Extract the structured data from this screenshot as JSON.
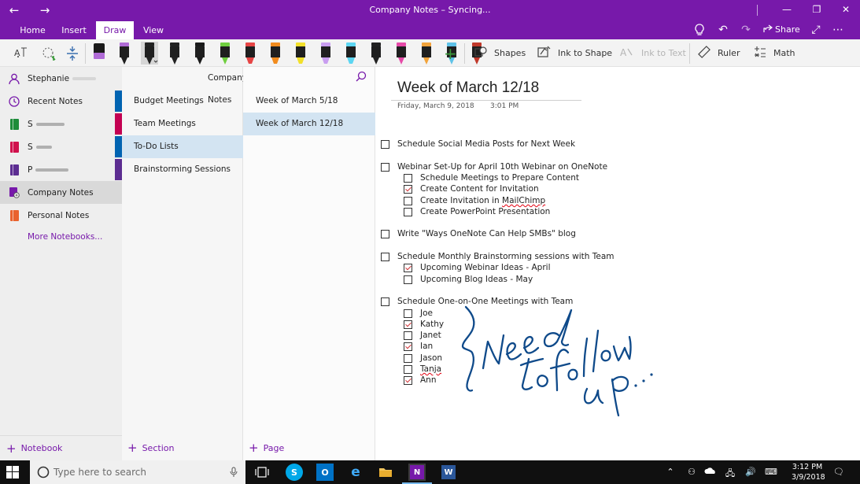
{
  "titlebar": {
    "title": "Company Notes – Syncing...",
    "back_icon": "←",
    "forward_icon": "→",
    "minimize_icon": "—",
    "restore_icon": "❐",
    "close_icon": "✕"
  },
  "ribbon": {
    "tabs": [
      {
        "label": "Home"
      },
      {
        "label": "Insert"
      },
      {
        "label": "Draw"
      },
      {
        "label": "View"
      }
    ],
    "active_tab": "Draw",
    "share_label": "Share",
    "lightbulb_icon": "💡",
    "undo_icon": "↶",
    "redo_icon": "↷",
    "fullscreen_icon": "⤢",
    "more_icon": "⋯"
  },
  "toolbar": {
    "pen_colors": [
      "#b06bd6",
      "#222222",
      "#222222",
      "#1a1a1a",
      "#6fcf3f",
      "#e64545",
      "#f28c1e",
      "#f2e02a",
      "#c99ef0",
      "#5cd6f2",
      "#222222",
      "#e64aa8",
      "#f2a33a",
      "#5ec2e8",
      "#c0392b"
    ],
    "shapes_label": "Shapes",
    "ink_to_shape_label": "Ink to Shape",
    "ink_to_text_label": "Ink to Text",
    "ruler_label": "Ruler",
    "math_label": "Math",
    "add_pen_icon": "+"
  },
  "leftnav": {
    "user": "Stephanie",
    "recent_notes": "Recent Notes",
    "notebooks": [
      {
        "label": "S",
        "color": "#1e8c3a"
      },
      {
        "label": "S",
        "color": "#d0104c"
      },
      {
        "label": "P",
        "color": "#5c2d91"
      }
    ],
    "company_notes": "Company Notes",
    "company_notes_color": "#7719aa",
    "personal_notes": "Personal Notes",
    "personal_notes_color": "#e9622e",
    "more_notebooks": "More Notebooks...",
    "add_notebook": "Notebook"
  },
  "sections": {
    "header": "Company Notes",
    "items": [
      {
        "label": "Budget Meetings",
        "color": "#0063b1"
      },
      {
        "label": "Team Meetings",
        "color": "#c30052"
      },
      {
        "label": "To-Do Lists",
        "color": "#0063b1"
      },
      {
        "label": "Brainstorming Sessions",
        "color": "#5c2d91"
      }
    ],
    "add_section": "Section"
  },
  "pages": {
    "items": [
      {
        "label": "Week of March 5/18"
      },
      {
        "label": "Week of March 12/18"
      }
    ],
    "add_page": "Page"
  },
  "note": {
    "title": "Week of March 12/18",
    "date": "Friday, March 9, 2018",
    "time": "3:01 PM",
    "todos": [
      {
        "text": "Schedule Social Media Posts for Next Week",
        "checked": false,
        "level": 0
      },
      {
        "text": "Webinar Set-Up for April 10th Webinar on OneNote",
        "checked": false,
        "level": 0
      },
      {
        "text": "Schedule Meetings to Prepare Content",
        "checked": false,
        "level": 1
      },
      {
        "text": "Create Content for Invitation",
        "checked": true,
        "level": 1
      },
      {
        "text": "Create Invitation in MailChimp",
        "checked": false,
        "level": 1
      },
      {
        "text": "Create PowerPoint Presentation",
        "checked": false,
        "level": 1
      },
      {
        "text": "Write \"Ways OneNote Can Help SMBs\" blog",
        "checked": false,
        "level": 0
      },
      {
        "text": "Schedule Monthly Brainstorming sessions with Team",
        "checked": false,
        "level": 0
      },
      {
        "text": "Upcoming Webinar Ideas - April",
        "checked": true,
        "level": 1
      },
      {
        "text": "Upcoming Blog Ideas - May",
        "checked": false,
        "level": 1
      },
      {
        "text": "Schedule One-on-One Meetings with Team",
        "checked": false,
        "level": 0
      },
      {
        "text": "Joe",
        "checked": false,
        "level": 1
      },
      {
        "text": "Kathy",
        "checked": true,
        "level": 1
      },
      {
        "text": "Janet",
        "checked": false,
        "level": 1
      },
      {
        "text": "Ian",
        "checked": true,
        "level": 1
      },
      {
        "text": "Jason",
        "checked": false,
        "level": 1
      },
      {
        "text": "Tanja",
        "checked": false,
        "level": 1
      },
      {
        "text": "Ann",
        "checked": true,
        "level": 1
      }
    ],
    "ink_color": "#0f4a8a"
  },
  "taskbar": {
    "search_placeholder": "Type here to search",
    "time": "3:12 PM",
    "date": "3/9/2018",
    "apps": [
      "task-view",
      "skype",
      "outlook",
      "edge",
      "file-explorer",
      "onenote",
      "word"
    ],
    "active_app": "onenote"
  }
}
